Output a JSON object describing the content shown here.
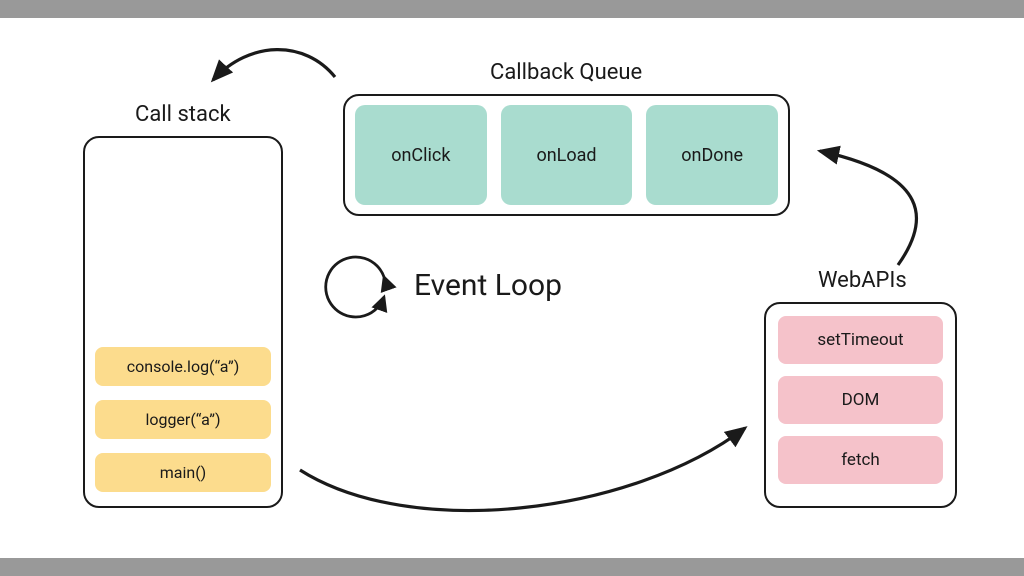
{
  "callstack": {
    "title": "Call stack",
    "items": [
      "console.log(“a”)",
      "logger(“a”)",
      "main()"
    ]
  },
  "callback_queue": {
    "title": "Callback Queue",
    "items": [
      "onClick",
      "onLoad",
      "onDone"
    ]
  },
  "event_loop": {
    "label": "Event Loop"
  },
  "webapis": {
    "title": "WebAPIs",
    "items": [
      "setTimeout",
      "DOM",
      "fetch"
    ]
  },
  "colors": {
    "stack_item": "#fcdc8d",
    "queue_item": "#a9dccf",
    "api_item": "#f5c2ca",
    "border": "#1a1a1a",
    "bar": "#999999"
  }
}
